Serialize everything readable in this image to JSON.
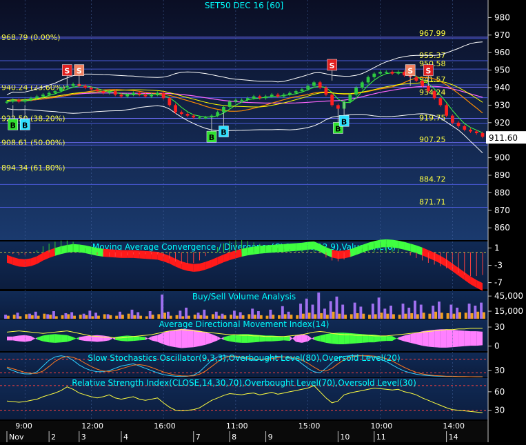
{
  "chart_data": [
    {
      "type": "line",
      "subtype": "candlestick",
      "title": "SET50 DEC 16  [60]",
      "ylim": [
        853,
        990
      ],
      "y_ticks": [
        860,
        870,
        880,
        890,
        900,
        910,
        920,
        930,
        940,
        950,
        960,
        970,
        980
      ],
      "last_price": "911.60",
      "fib_levels": [
        {
          "value": 968.79,
          "label": "968.79 (0.00%)"
        },
        {
          "value": 940.24,
          "label": "940.24 (23.60%)"
        },
        {
          "value": 922.5,
          "label": "922.50 (38.20%)"
        },
        {
          "value": 908.61,
          "label": "908.61 (50.00%)"
        },
        {
          "value": 894.34,
          "label": "894.34 (61.80%)"
        }
      ],
      "price_levels": [
        {
          "value": 967.99,
          "label": "967.99"
        },
        {
          "value": 955.37,
          "label": "955.37"
        },
        {
          "value": 950.58,
          "label": "950.58"
        },
        {
          "value": 941.57,
          "label": "941.57"
        },
        {
          "value": 934.24,
          "label": "934.24"
        },
        {
          "value": 919.75,
          "label": "919.75"
        },
        {
          "value": 907.25,
          "label": "907.25"
        },
        {
          "value": 884.72,
          "label": "884.72"
        },
        {
          "value": 871.71,
          "label": "871.71"
        }
      ],
      "close_series": [
        932,
        933,
        932,
        933,
        934,
        935,
        936,
        937,
        938,
        940,
        941,
        942,
        941,
        940,
        939,
        938,
        937,
        938,
        936,
        935,
        936,
        937,
        936,
        935,
        936,
        937,
        934,
        930,
        926,
        925,
        924,
        923,
        923,
        923,
        924,
        926,
        929,
        932,
        933,
        933,
        934,
        935,
        934,
        935,
        936,
        935,
        936,
        937,
        938,
        939,
        941,
        943,
        940,
        936,
        930,
        928,
        932,
        936,
        940,
        943,
        946,
        948,
        949,
        949,
        948,
        949,
        947,
        946,
        944,
        941,
        938,
        934,
        930,
        924,
        920,
        918,
        916,
        915,
        914,
        912
      ],
      "signals": [
        {
          "label": "S",
          "index": 10,
          "value": 950
        },
        {
          "label": "S",
          "index": 12,
          "value": 950
        },
        {
          "label": "S",
          "index": 54,
          "value": 953
        },
        {
          "label": "S",
          "index": 67,
          "value": 950
        },
        {
          "label": "S",
          "index": 70,
          "value": 950
        },
        {
          "label": "B",
          "index": 1,
          "value": 919
        },
        {
          "label": "B",
          "index": 3,
          "value": 919
        },
        {
          "label": "B",
          "index": 34,
          "value": 912
        },
        {
          "label": "B",
          "index": 36,
          "value": 915
        },
        {
          "label": "B",
          "index": 55,
          "value": 917
        },
        {
          "label": "B",
          "index": 56,
          "value": 921
        }
      ],
      "x_tick_labels": [
        "9:00",
        "12:00",
        "16:00",
        "11:00",
        "15:00",
        "10:00",
        "14:00"
      ],
      "date_labels": [
        "Nov",
        "2",
        "3",
        "4",
        "7",
        "8",
        "9",
        "10",
        "11",
        "14"
      ]
    },
    {
      "type": "area",
      "title": "Moving Average Convergence / Divergence(CLOSE,26,12,9),Value Line(0)",
      "ylim": [
        -8.5,
        2.5
      ],
      "y_ticks": [
        1,
        -3,
        -7
      ],
      "values": [
        -1.5,
        -2.0,
        -2.4,
        -2.5,
        -2.3,
        -1.8,
        -1.0,
        -0.4,
        0.1,
        0.5,
        0.8,
        1.0,
        0.9,
        0.7,
        0.4,
        0.1,
        -0.1,
        -0.2,
        -0.3,
        -0.4,
        -0.4,
        -0.4,
        -0.5,
        -0.6,
        -0.7,
        -0.8,
        -1.2,
        -1.7,
        -2.4,
        -3.0,
        -3.4,
        -3.6,
        -3.5,
        -3.1,
        -2.6,
        -2.0,
        -1.4,
        -0.9,
        -0.5,
        -0.1,
        0.2,
        0.4,
        0.6,
        0.7,
        0.8,
        0.9,
        1.0,
        1.1,
        1.2,
        1.3,
        1.5,
        1.6,
        1.0,
        0.3,
        -0.3,
        -0.6,
        -0.5,
        -0.2,
        0.3,
        0.8,
        1.3,
        1.7,
        2.0,
        2.1,
        2.0,
        1.8,
        1.5,
        1.1,
        0.7,
        0.2,
        -0.4,
        -1.0,
        -1.7,
        -2.5,
        -3.5,
        -4.5,
        -5.5,
        -6.5,
        -7.3,
        -8.0
      ]
    },
    {
      "type": "bar",
      "title": "Buy/Sell Volume Analysis",
      "ylim": [
        0,
        52000
      ],
      "y_ticks": [
        45000,
        15000
      ],
      "y_tick_labels": [
        "45,000",
        "15,000"
      ],
      "series": [
        {
          "color": "#f0a020",
          "values": [
            6000,
            8000,
            5000,
            9000,
            7000,
            6000,
            10000,
            8000,
            5000,
            7000,
            9000,
            6000,
            8000,
            7000,
            5000,
            6000,
            9000,
            7000,
            6000,
            8000,
            10000,
            7000,
            6000,
            5000,
            8000,
            9000,
            12000,
            6000,
            7000,
            5000,
            6000,
            8000,
            7000,
            6000,
            9000,
            6000,
            7000,
            8000,
            6000,
            7000,
            9000,
            8000,
            7000,
            6000,
            8000,
            7000,
            9000,
            8000,
            7000,
            10000,
            12000,
            9000,
            11000,
            8000,
            14000,
            10000,
            8000,
            9000,
            11000,
            10000,
            8000,
            9000,
            12000,
            10000,
            9000,
            8000,
            10000,
            11000,
            9000,
            12000,
            10000,
            14000,
            12000,
            11000,
            10000,
            13000,
            12000,
            11000,
            14000,
            13000
          ]
        },
        {
          "color": "#a070f0",
          "values": [
            8000,
            0,
            12000,
            0,
            10000,
            14000,
            0,
            9000,
            15000,
            0,
            11000,
            13000,
            0,
            10000,
            16000,
            12000,
            0,
            9000,
            0,
            14000,
            0,
            18000,
            13000,
            0,
            15000,
            0,
            48000,
            14000,
            0,
            16000,
            22000,
            0,
            12000,
            18000,
            0,
            14000,
            10000,
            0,
            16000,
            13000,
            0,
            20000,
            15000,
            0,
            18000,
            0,
            25000,
            14000,
            0,
            30000,
            40000,
            28000,
            52000,
            20000,
            35000,
            44000,
            28000,
            0,
            32000,
            24000,
            0,
            30000,
            42000,
            20000,
            26000,
            0,
            30000,
            22000,
            36000,
            28000,
            0,
            26000,
            34000,
            0,
            28000,
            22000,
            0,
            30000,
            26000,
            32000
          ]
        }
      ]
    },
    {
      "type": "area",
      "title": "Average Directional Movement Index(14)",
      "ylim": [
        -8,
        42
      ],
      "y_ticks": [
        30,
        0
      ],
      "adx_values": [
        22,
        23,
        24,
        23,
        22,
        21,
        20,
        21,
        22,
        23,
        24,
        22,
        20,
        18,
        16,
        15,
        14,
        14,
        13,
        13,
        14,
        15,
        16,
        17,
        18,
        20,
        22,
        24,
        25,
        26,
        25,
        24,
        23,
        22,
        21,
        20,
        19,
        18,
        18,
        17,
        17,
        16,
        16,
        15,
        15,
        15,
        15,
        16,
        17,
        18,
        20,
        22,
        23,
        22,
        20,
        19,
        18,
        18,
        17,
        17,
        17,
        16,
        16,
        16,
        17,
        18,
        19,
        20,
        21,
        22,
        23,
        24,
        25,
        26,
        26,
        27,
        27,
        28,
        28,
        28
      ],
      "di_spread": [
        -4,
        -4,
        -6,
        -7,
        -5,
        2,
        6,
        8,
        9,
        8,
        7,
        3,
        -3,
        -5,
        -6,
        -7,
        -6,
        -4,
        3,
        5,
        6,
        5,
        4,
        3,
        -4,
        -7,
        -12,
        -16,
        -18,
        -20,
        -19,
        -18,
        -16,
        -13,
        -9,
        -4,
        3,
        6,
        8,
        9,
        9,
        8,
        7,
        6,
        6,
        5,
        4,
        5,
        -7,
        -9,
        -6,
        3,
        6,
        9,
        11,
        12,
        12,
        11,
        10,
        9,
        8,
        8,
        6,
        5,
        5,
        -2,
        -6,
        -9,
        -12,
        -15,
        -17,
        -18,
        -19,
        -19,
        -18,
        -17,
        -16,
        -15,
        -15,
        -14
      ]
    },
    {
      "type": "line",
      "title": "Slow Stochastics Oscillator(9,3,3),Overbought Level(80),Oversold Level(20)",
      "ylim": [
        0,
        100
      ],
      "y_ticks": [
        30
      ],
      "overbought": 80,
      "oversold": 20,
      "k_values": [
        40,
        30,
        20,
        15,
        15,
        25,
        50,
        75,
        90,
        95,
        90,
        75,
        55,
        40,
        30,
        25,
        25,
        30,
        40,
        50,
        55,
        60,
        50,
        40,
        30,
        20,
        12,
        8,
        5,
        4,
        5,
        10,
        25,
        50,
        75,
        90,
        95,
        92,
        88,
        85,
        80,
        75,
        78,
        82,
        88,
        92,
        90,
        85,
        80,
        60,
        40,
        25,
        20,
        40,
        65,
        85,
        92,
        95,
        96,
        95,
        92,
        88,
        80,
        70,
        55,
        40,
        28,
        20,
        14,
        10,
        8,
        6,
        5,
        4,
        4,
        3,
        3,
        3,
        2,
        2
      ],
      "d_values": [
        45,
        38,
        30,
        22,
        18,
        18,
        28,
        48,
        70,
        85,
        92,
        88,
        78,
        62,
        48,
        36,
        28,
        26,
        30,
        38,
        46,
        54,
        56,
        52,
        44,
        34,
        24,
        16,
        10,
        7,
        6,
        7,
        14,
        28,
        48,
        68,
        85,
        93,
        93,
        89,
        85,
        81,
        79,
        79,
        82,
        87,
        90,
        89,
        85,
        76,
        62,
        45,
        30,
        28,
        40,
        60,
        78,
        89,
        94,
        95,
        95,
        93,
        89,
        82,
        72,
        58,
        44,
        32,
        22,
        15,
        11,
        8,
        7,
        5,
        5,
        4,
        4,
        3,
        3,
        3
      ]
    },
    {
      "type": "line",
      "title": "Relative Strength Index(CLOSE,14,30,70),Overbought Level(70),Oversold Level(30)",
      "ylim": [
        15,
        80
      ],
      "y_ticks": [
        60,
        30
      ],
      "overbought": 70,
      "oversold": 30,
      "values": [
        45,
        44,
        43,
        44,
        46,
        48,
        52,
        55,
        58,
        62,
        68,
        64,
        58,
        55,
        52,
        50,
        52,
        55,
        50,
        48,
        50,
        52,
        48,
        46,
        48,
        50,
        42,
        35,
        30,
        29,
        30,
        31,
        34,
        40,
        46,
        50,
        54,
        57,
        56,
        55,
        57,
        58,
        55,
        57,
        59,
        56,
        58,
        60,
        62,
        64,
        66,
        70,
        60,
        50,
        42,
        45,
        55,
        58,
        60,
        62,
        64,
        66,
        65,
        64,
        63,
        64,
        60,
        58,
        55,
        50,
        46,
        42,
        38,
        34,
        31,
        30,
        29,
        28,
        27,
        26
      ]
    }
  ]
}
